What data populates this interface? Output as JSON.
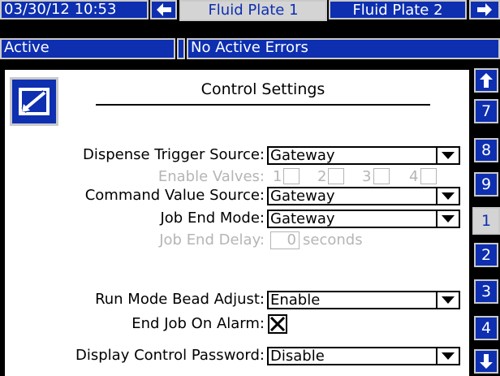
{
  "header": {
    "datetime": "03/30/12 10:53",
    "status": "Active",
    "errors": "No Active Errors",
    "tabs": [
      {
        "label": "Fluid Plate 1",
        "active": true
      },
      {
        "label": "Fluid Plate 2",
        "active": false
      }
    ]
  },
  "panel": {
    "title": "Control Settings",
    "icon": "edit-icon"
  },
  "settings": {
    "dispense_trigger": {
      "label": "Dispense Trigger Source:",
      "value": "Gateway"
    },
    "enable_valves": {
      "label": "Enable Valves:",
      "options": [
        "1",
        "2",
        "3",
        "4"
      ]
    },
    "command_value": {
      "label": "Command Value Source:",
      "value": "Gateway"
    },
    "job_end_mode": {
      "label": "Job End Mode:",
      "value": "Gateway"
    },
    "job_end_delay": {
      "label": "Job End Delay:",
      "value": "0",
      "unit": "seconds"
    },
    "run_mode_bead": {
      "label": "Run Mode Bead Adjust:",
      "value": "Enable"
    },
    "end_job_alarm": {
      "label": "End Job On Alarm:",
      "checked": true
    },
    "display_password": {
      "label": "Display Control Password:",
      "value": "Disable"
    }
  },
  "sidebar": {
    "pages": [
      "7",
      "8",
      "9",
      "1",
      "2",
      "3",
      "4"
    ],
    "active_page": "1"
  },
  "colors": {
    "accent": "#0d2fb0",
    "frame": "#c9c9c9",
    "disabled": "#b5b5b5"
  }
}
